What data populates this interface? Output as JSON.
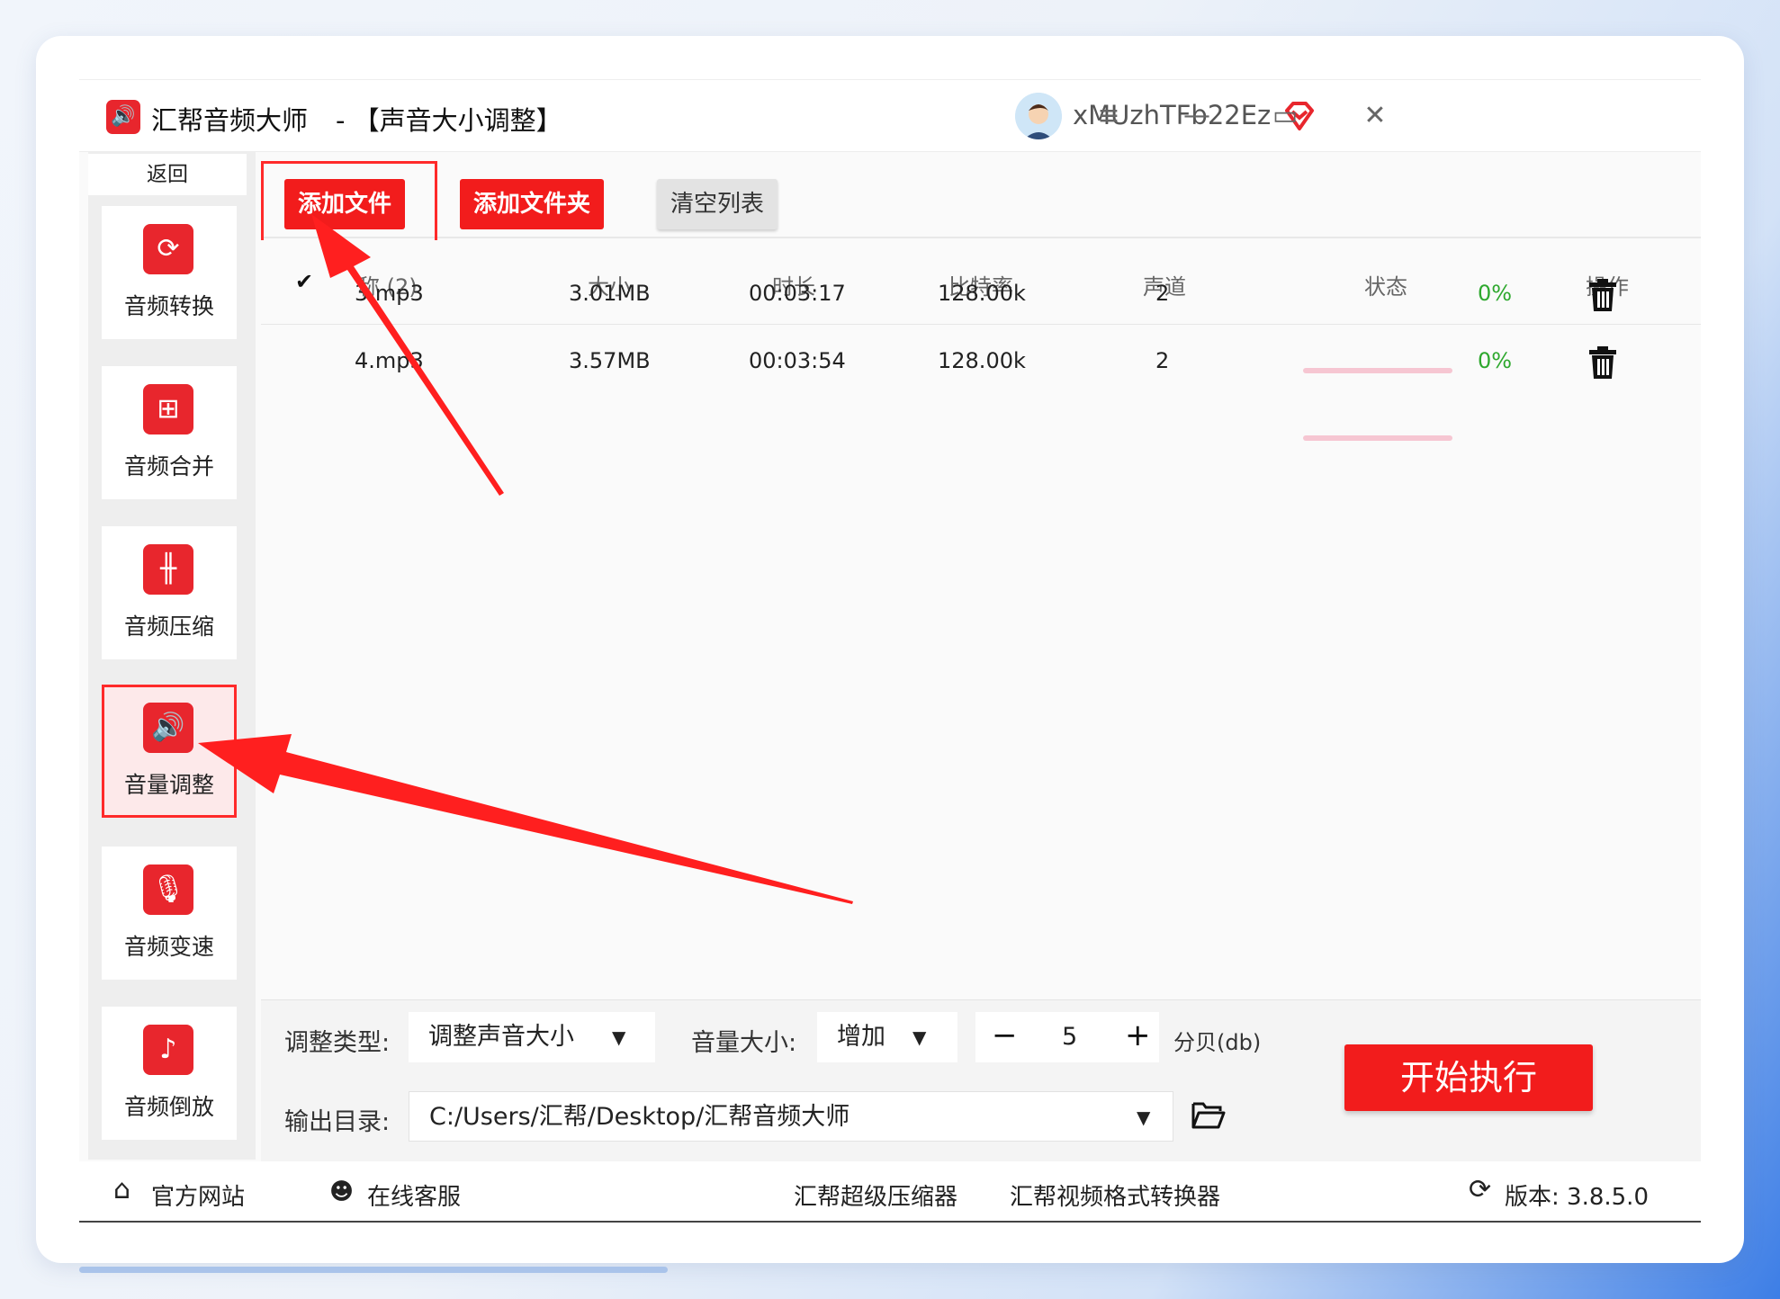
{
  "window": {
    "app_name": "汇帮音频大师",
    "title_suffix": "-  【声音大小调整】",
    "username": "xMUzhTFb22Ez",
    "menu_icon": "≡",
    "minimize_icon": "—",
    "maximize_icon": "▭",
    "close_icon": "✕"
  },
  "sidebar": {
    "back_label": "返回",
    "items": [
      {
        "label": "音频转换",
        "icon": "audio-convert-icon"
      },
      {
        "label": "音频合并",
        "icon": "audio-merge-icon"
      },
      {
        "label": "音频压缩",
        "icon": "audio-compress-icon"
      },
      {
        "label": "音量调整",
        "icon": "volume-adjust-icon"
      },
      {
        "label": "音频变速",
        "icon": "audio-speed-icon"
      },
      {
        "label": "音频倒放",
        "icon": "audio-reverse-icon"
      }
    ]
  },
  "toolbar": {
    "add_file": "添加文件",
    "add_folder": "添加文件夹",
    "clear_list": "清空列表"
  },
  "table": {
    "headers": {
      "name": "称 (2)",
      "size": "大小",
      "duration": "时长",
      "bitrate": "比特率",
      "channels": "声道",
      "status": "状态",
      "action": "操作"
    },
    "rows": [
      {
        "name": "3.mp3",
        "size": "3.01MB",
        "duration": "00:03:17",
        "bitrate": "128.00k",
        "channels": "2",
        "status_pct": "0%",
        "progress": 0
      },
      {
        "name": "4.mp3",
        "size": "3.57MB",
        "duration": "00:03:54",
        "bitrate": "128.00k",
        "channels": "2",
        "status_pct": "0%",
        "progress": 0
      }
    ]
  },
  "settings": {
    "adjust_type_label": "调整类型:",
    "adjust_type_value": "调整声音大小",
    "volume_label": "音量大小:",
    "volume_direction": "增加",
    "minus": "−",
    "amount": "5",
    "plus": "+",
    "unit": "分贝(db)",
    "output_label": "输出目录:",
    "output_path": "C:/Users/汇帮/Desktop/汇帮音频大师",
    "start_button": "开始执行"
  },
  "statusbar": {
    "website": "官方网站",
    "support": "在线客服",
    "compressor": "汇帮超级压缩器",
    "video_converter": "汇帮视频格式转换器",
    "version": "版本: 3.8.5.0"
  },
  "colors": {
    "accent_red": "#f21c1c",
    "highlight_border": "#ff2a2a",
    "progress_track": "#f6c6d2",
    "percent_green": "#2ea82e"
  }
}
